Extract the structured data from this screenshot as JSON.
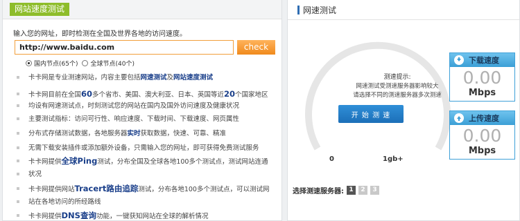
{
  "left": {
    "title": "网站速度测试",
    "intro": "输入您的网址，即时检测在全国及世界各地的访问速度。",
    "url_value": "http://www.baidu.com",
    "check_label": "check",
    "node_options": [
      "国内节点(65个)",
      "全球节点(40个)"
    ],
    "bullets": [
      {
        "a": "卡卡网是专业测速网站，内容主要包括",
        "b": "网速测试",
        "c": "及",
        "d": "网站速度测试",
        "e": ""
      },
      {
        "a": "卡卡网目前在全国",
        "b": "60",
        "c": "多个省市、美国、澳大利亚、日本、英国等近",
        "d": "20",
        "e": "个国家地区"
      },
      {
        "a": "均设有网速测试点，时刻测试您的网站在国内及国外访问速度及健康状况"
      },
      {
        "a": "主要测试指标：访问可行性、响应速度、下载时间、下载速度、网页属性"
      },
      {
        "a": "分布式存储测试数据，各地服务器",
        "b": "实时",
        "c": "获取数据，快速、可靠、精准"
      },
      {
        "a": "无需下载安装插件或添加额外设备，只需输入您的网址，即可获得免费测试服务"
      },
      {
        "a": "卡卡网提供",
        "b": "全球Ping",
        "c": "测试，分布全国及全球各地100多个测试点，测试网站连通"
      },
      {
        "a": "状况"
      },
      {
        "a": "卡卡网提供网站",
        "b": "Tracert路由追踪",
        "c": "测试，分布各地100多个测试点，可以测试网"
      },
      {
        "a": "站在各地访问的所经路线"
      },
      {
        "a": "卡卡网提供",
        "b": "DNS查询",
        "c": "功能，一键获知网站在全球的解析情况"
      }
    ]
  },
  "right": {
    "title": "网速测试",
    "tip_title": "测速提示:",
    "tip_line1": "网速测试受测速服务器影响较大",
    "tip_line2": "请选择不同的测速服务器多次测速",
    "start_label": "开 始 测 速",
    "scale_min": "0",
    "scale_max": "1gb+",
    "servers_label": "选择测速服务器:",
    "servers": [
      "1",
      "2",
      "3"
    ],
    "download": {
      "label": "下载速度",
      "value": "0.00",
      "unit": "Mbps"
    },
    "upload": {
      "label": "上传速度",
      "value": "0.00",
      "unit": "Mbps"
    }
  },
  "colors": {
    "accent_green": "#8ebd2b",
    "accent_orange": "#f08a1c",
    "accent_blue": "#3b9fd6",
    "link_blue": "#1a3f8a"
  },
  "icons": {
    "download": "arrow-down-icon",
    "upload": "arrow-up-icon"
  }
}
